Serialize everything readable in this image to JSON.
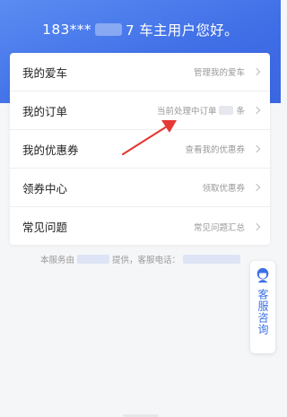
{
  "header": {
    "greeting_prefix": "183***",
    "greeting_suffix": "7 车主用户您好。"
  },
  "menu": {
    "items": [
      {
        "title": "我的爱车",
        "subtitle": "管理我的爱车",
        "masked": false
      },
      {
        "title": "我的订单",
        "subtitle": "当前处理中订单",
        "subtitle_after": "条",
        "masked": true
      },
      {
        "title": "我的优惠券",
        "subtitle": "查看我的优惠券",
        "masked": false
      },
      {
        "title": "领券中心",
        "subtitle": "领取优惠券",
        "masked": false
      },
      {
        "title": "常见问题",
        "subtitle": "常见问题汇总",
        "masked": false
      }
    ]
  },
  "footer": {
    "prefix": "本服务由",
    "middle": "提供，客服电话："
  },
  "customer_service": {
    "label": "客服咨询",
    "accent_color": "#3b6fe6"
  },
  "colors": {
    "header_bg": "#4a7aec",
    "annotation_arrow": "#e53935"
  }
}
